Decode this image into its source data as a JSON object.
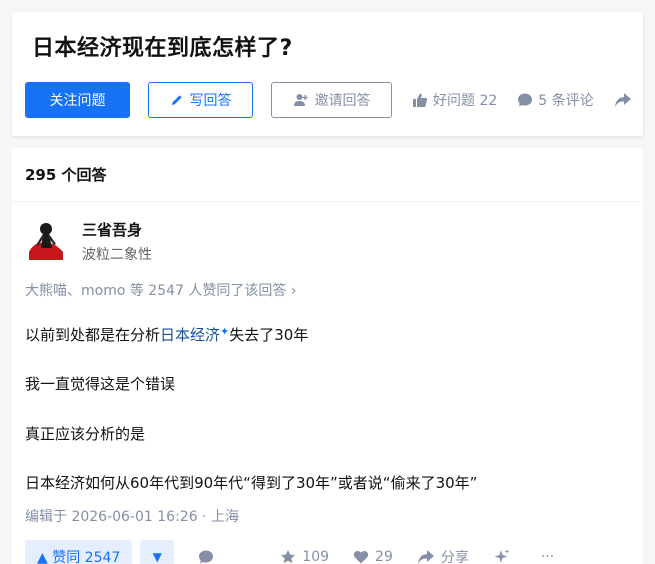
{
  "question": {
    "title": "日本经济现在到底怎样了?",
    "follow_label": "关注问题",
    "write_label": "写回答",
    "invite_label": "邀请回答",
    "good_question_label": "好问题 22",
    "comments_label": "5 条评论"
  },
  "answers": {
    "count_label": "295 个回答",
    "author": {
      "name": "三省吾身",
      "bio": "波粒二象性"
    },
    "voters_text": "大熊喵、momo 等 2547 人赞同了该回答 ›",
    "content": {
      "p1_pre": "以前到处都是在分析",
      "p1_keyword": "日本经济",
      "p1_star": "✦",
      "p1_post": "失去了30年",
      "p2": "我一直觉得这是个错误",
      "p3": "真正应该分析的是",
      "p4": "日本经济如何从60年代到90年代“得到了30年”或者说“偷来了30年”"
    },
    "edit_time": "编辑于 2026-06-01 16:26 · 上海",
    "footer": {
      "upvote_label": "▲ 赞同 2547",
      "downvote_label": "▼",
      "comment_label": "",
      "favorite_count": "109",
      "like_count": "29",
      "share_label": "分享",
      "more_label": "···"
    }
  },
  "colors": {
    "brand": "#1772f6",
    "muted": "#8590a6",
    "keyword": "#175199",
    "vote_bg": "#e5eefd"
  }
}
